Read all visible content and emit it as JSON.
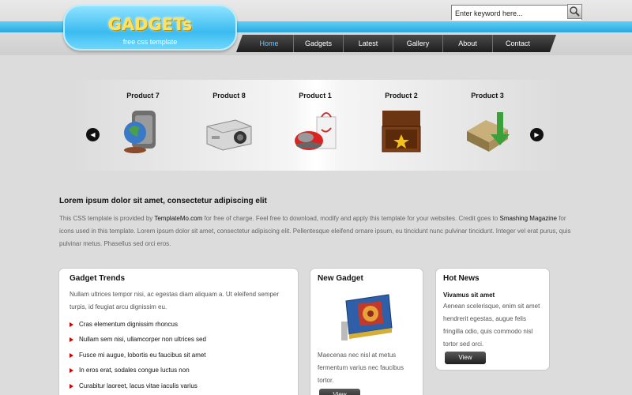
{
  "logo": {
    "title": "GADGETs",
    "subtitle": "free css template"
  },
  "search": {
    "value": "Enter keyword here..."
  },
  "nav": [
    "Home",
    "Gadgets",
    "Latest",
    "Gallery",
    "About",
    "Contact"
  ],
  "slider": {
    "products": [
      "Product 7",
      "Product 8",
      "Product 1",
      "Product 2",
      "Product 3"
    ]
  },
  "intro": {
    "title": "Lorem ipsum dolor sit amet, consectetur adipiscing elit",
    "p1": "This CSS template is provided by ",
    "templatemo": "TemplateMo.com",
    "p2": " for free of charge. Feel free to download, modify and apply this template for your websites. Credit goes to ",
    "smashing": "Smashing",
    "magazine": "Magazine",
    "p3": " for icons used in this template. Lorem ipsum dolor sit amet, consectetur adipiscing elit. Pellentesque eleifend ornare ipsum, eu tincidunt nunc pulvinar tincidunt. Integer vel erat purus, quis pulvinar metus. Phasellus sed orci eros."
  },
  "trends": {
    "title": "Gadget Trends",
    "text": "Nullam ultrices tempor nisi, ac egestas diam aliquam a. Ut eleifend semper turpis, id feugiat arcu dignissim eu.",
    "items": [
      "Cras elementum dignissim rhoncus",
      "Nullam sem nisi, ullamcorper non ultrices sed",
      "Fusce mi augue, lobortis eu faucibus sit amet",
      "In eros erat, sodales congue luctus non",
      "Curabitur laoreet, lacus vitae iaculis varius"
    ]
  },
  "new_gadget": {
    "title": "New Gadget",
    "text": "Maecenas nec nisl at metus fermentum varius nec faucibus tortor.",
    "button": "View"
  },
  "hot_news": {
    "title": "Hot News",
    "headline": "Vivamus sit amet",
    "text": "Aenean scelerisque, enim sit amet hendrerit egestas, augue felis fringilla odio, quis commodo nisl tortor sed orci.",
    "button": "View"
  }
}
